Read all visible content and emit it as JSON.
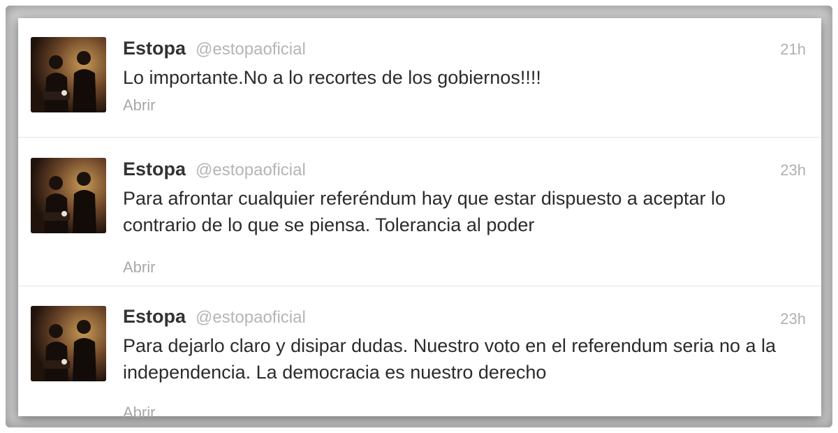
{
  "tweets": [
    {
      "name": "Estopa",
      "handle": "@estopaoficial",
      "time": "21h",
      "text": "Lo importante.No a lo recortes de los gobiernos!!!!",
      "action": "Abrir"
    },
    {
      "name": "Estopa",
      "handle": "@estopaoficial",
      "time": "23h",
      "text": "Para afrontar cualquier referéndum hay que estar dispuesto a aceptar lo contrario de lo que se piensa. Tolerancia al poder",
      "action": "Abrir"
    },
    {
      "name": "Estopa",
      "handle": "@estopaoficial",
      "time": "23h",
      "text": "Para dejarlo claro y disipar dudas. Nuestro voto en el referendum seria no a la independencia. La democracia es nuestro derecho",
      "action": "Abrir"
    }
  ],
  "colors": {
    "name": "#333333",
    "handle": "#b5b5b5",
    "text": "#2b2b2b",
    "muted": "#a8a8a8",
    "divider": "#e6e6e6"
  }
}
